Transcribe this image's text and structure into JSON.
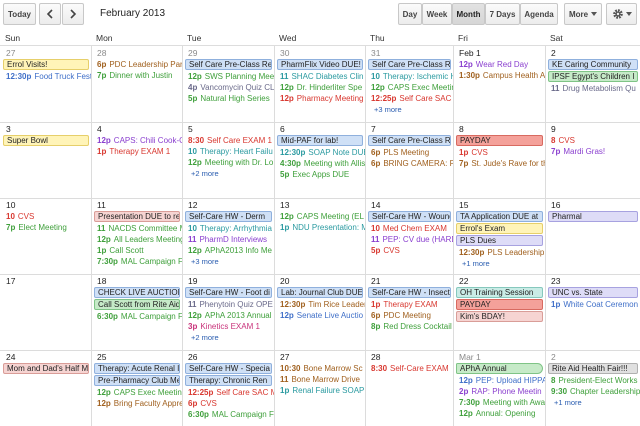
{
  "toolbar": {
    "today_label": "Today",
    "prev_icon": "chevron-left-icon",
    "next_icon": "chevron-right-icon",
    "date_range": "February 2013",
    "views": [
      "Day",
      "Week",
      "Month",
      "7 Days",
      "Agenda"
    ],
    "active_view": "Month",
    "more_label": "More",
    "settings_icon": "gear-icon"
  },
  "colors": {
    "blue": "#3f6fc8",
    "green": "#3e9f3a",
    "purple": "#8a3fcf",
    "brown": "#a0601e",
    "red": "#d8372f",
    "teal": "#2a9aa0",
    "olive": "#6a7a1a",
    "pink": "#c8327a",
    "slate": "#6a6a8a",
    "chip_yellow": "#fff4b8",
    "chip_yellow_border": "#e6cf6a",
    "chip_blue": "#cfe0f6",
    "chip_blue_border": "#8fb0dd",
    "chip_red": "#f4a19a",
    "chip_red_border": "#d86a60",
    "chip_rose": "#f6d4d2",
    "chip_rose_border": "#d99d98",
    "chip_green": "#c6eac8",
    "chip_green_border": "#7fc486",
    "chip_gray": "#e0e0e0",
    "chip_gray_border": "#b0b0b0",
    "chip_lavender": "#dedcf7",
    "chip_lavender_border": "#a7a2e0",
    "chip_teal": "#c9ece6",
    "chip_teal_border": "#86c8bd",
    "today_bg": "#fffbd9"
  },
  "days_of_week": [
    "Sun",
    "Mon",
    "Tue",
    "Wed",
    "Thu",
    "Fri",
    "Sat"
  ],
  "weeks": [
    [
      {
        "day": "27",
        "other": true,
        "items": [
          {
            "kind": "chip",
            "text": "Errol Visits!",
            "style": "yellow"
          },
          {
            "kind": "ev",
            "time": "12:30p",
            "text": "Food Truck Fest",
            "color": "blue"
          }
        ]
      },
      {
        "day": "28",
        "other": true,
        "items": [
          {
            "kind": "ev",
            "time": "6p",
            "text": "PDC Leadership Par",
            "color": "brown"
          },
          {
            "kind": "ev",
            "time": "7p",
            "text": "Dinner with Justin",
            "color": "green"
          }
        ]
      },
      {
        "day": "29",
        "other": true,
        "items": [
          {
            "kind": "chip",
            "text": "Self Care Pre-Class Re",
            "style": "blue"
          },
          {
            "kind": "ev",
            "time": "12p",
            "text": "SWS Planning Mee",
            "color": "green"
          },
          {
            "kind": "ev",
            "time": "4p",
            "text": "Vancomycin Quiz CL",
            "color": "slate"
          },
          {
            "kind": "ev",
            "time": "5p",
            "text": "Natural High Series",
            "color": "green"
          }
        ]
      },
      {
        "day": "30",
        "other": true,
        "items": [
          {
            "kind": "chip",
            "text": "PharmFlix Video DUE!",
            "style": "blue"
          },
          {
            "kind": "ev",
            "time": "11",
            "text": "SHAC Diabetes Clin",
            "color": "teal"
          },
          {
            "kind": "ev",
            "time": "12p",
            "text": "Dr. Hinderliter Spe",
            "color": "green"
          },
          {
            "kind": "ev",
            "time": "12p",
            "text": "Pharmacy Meeting",
            "color": "red"
          }
        ]
      },
      {
        "day": "31",
        "other": true,
        "items": [
          {
            "kind": "chip",
            "text": "Self Care Pre-Class Re",
            "style": "blue"
          },
          {
            "kind": "ev",
            "time": "10",
            "text": "Therapy: Ischemic H",
            "color": "teal"
          },
          {
            "kind": "ev",
            "time": "12p",
            "text": "CAPS Exec Meeting",
            "color": "green"
          },
          {
            "kind": "ev",
            "time": "12:25p",
            "text": "Self Care SAC M",
            "color": "red"
          }
        ],
        "more": "+3 more"
      },
      {
        "day": "Feb 1",
        "other": false,
        "items": [
          {
            "kind": "ev",
            "time": "12p",
            "text": "Wear Red Day",
            "color": "purple"
          },
          {
            "kind": "ev",
            "time": "1:30p",
            "text": "Campus Health A",
            "color": "brown"
          }
        ]
      },
      {
        "day": "2",
        "other": false,
        "items": [
          {
            "kind": "chip",
            "text": "KE Caring Community",
            "style": "blue"
          },
          {
            "kind": "chip",
            "text": "IPSF Egypt's Children I",
            "style": "green"
          },
          {
            "kind": "ev",
            "time": "11",
            "text": "Drug Metabolism Qu",
            "color": "slate"
          }
        ]
      }
    ],
    [
      {
        "day": "3",
        "other": false,
        "items": [
          {
            "kind": "chip",
            "text": "Super Bowl",
            "style": "yellow"
          }
        ]
      },
      {
        "day": "4",
        "other": false,
        "items": [
          {
            "kind": "ev",
            "time": "12p",
            "text": "CAPS: Chili Cook-O",
            "color": "purple"
          },
          {
            "kind": "ev",
            "time": "1p",
            "text": "Therapy EXAM 1",
            "color": "red"
          }
        ]
      },
      {
        "day": "5",
        "other": false,
        "items": [
          {
            "kind": "ev",
            "time": "8:30",
            "text": "Self Care EXAM 1",
            "color": "red"
          },
          {
            "kind": "ev",
            "time": "10",
            "text": "Therapy: Heart Failu",
            "color": "teal"
          },
          {
            "kind": "ev",
            "time": "12p",
            "text": "Meeting with Dr. Lo",
            "color": "green"
          }
        ],
        "more": "+2 more"
      },
      {
        "day": "6",
        "other": false,
        "items": [
          {
            "kind": "chip",
            "text": "Mid-PAF for lab!",
            "style": "blue"
          },
          {
            "kind": "ev",
            "time": "12:30p",
            "text": "SOAP Note DUE",
            "color": "teal"
          },
          {
            "kind": "ev",
            "time": "4:30p",
            "text": "Meeting with Allis",
            "color": "green"
          },
          {
            "kind": "ev",
            "time": "5p",
            "text": "Exec Apps DUE",
            "color": "green"
          }
        ]
      },
      {
        "day": "7",
        "other": false,
        "items": [
          {
            "kind": "chip",
            "text": "Self Care Pre-Class Re",
            "style": "blue"
          },
          {
            "kind": "ev",
            "time": "6p",
            "text": "PLS Meeting",
            "color": "brown"
          },
          {
            "kind": "ev",
            "time": "6p",
            "text": "BRING CAMERA: PD",
            "color": "brown"
          }
        ]
      },
      {
        "day": "8",
        "other": false,
        "items": [
          {
            "kind": "chip",
            "text": "PAYDAY",
            "style": "red"
          },
          {
            "kind": "ev",
            "time": "1p",
            "text": "CVS",
            "color": "red"
          },
          {
            "kind": "ev",
            "time": "7p",
            "text": "St. Jude's Rave for th",
            "color": "brown"
          }
        ]
      },
      {
        "day": "9",
        "other": false,
        "items": [
          {
            "kind": "ev",
            "time": "8",
            "text": "CVS",
            "color": "red"
          },
          {
            "kind": "ev",
            "time": "7p",
            "text": "Mardi Gras!",
            "color": "purple"
          }
        ]
      }
    ],
    [
      {
        "day": "10",
        "other": false,
        "items": [
          {
            "kind": "ev",
            "time": "10",
            "text": "CVS",
            "color": "red"
          },
          {
            "kind": "ev",
            "time": "7p",
            "text": "Elect Meeting",
            "color": "green"
          }
        ]
      },
      {
        "day": "11",
        "other": false,
        "items": [
          {
            "kind": "chip",
            "text": "Presentation DUE to re",
            "style": "rose"
          },
          {
            "kind": "ev",
            "time": "11",
            "text": "NACDS Committee M",
            "color": "green"
          },
          {
            "kind": "ev",
            "time": "12p",
            "text": "All Leaders Meeting",
            "color": "green"
          },
          {
            "kind": "ev",
            "time": "1p",
            "text": "Call Scott",
            "color": "green"
          },
          {
            "kind": "ev",
            "time": "7:30p",
            "text": "MAL Campaign F",
            "color": "green"
          }
        ]
      },
      {
        "day": "12",
        "other": false,
        "items": [
          {
            "kind": "chip",
            "text": "Self-Care HW - Derm",
            "style": "blue"
          },
          {
            "kind": "ev",
            "time": "10",
            "text": "Therapy: Arrhythmia",
            "color": "teal"
          },
          {
            "kind": "ev",
            "time": "11",
            "text": "PharmD Interviews",
            "color": "purple"
          },
          {
            "kind": "ev",
            "time": "12p",
            "text": "APhA2013 Info Me",
            "color": "green"
          }
        ],
        "more": "+3 more"
      },
      {
        "day": "13",
        "other": false,
        "items": [
          {
            "kind": "ev",
            "time": "12p",
            "text": "CAPS Meeting (EL",
            "color": "green"
          },
          {
            "kind": "ev",
            "time": "1p",
            "text": "NDU Presentation: M",
            "color": "teal"
          }
        ]
      },
      {
        "day": "14",
        "other": false,
        "items": [
          {
            "kind": "chip",
            "text": "Self-Care HW - Wound",
            "style": "blue"
          },
          {
            "kind": "ev",
            "time": "10",
            "text": "Med Chem EXAM",
            "color": "red"
          },
          {
            "kind": "ev",
            "time": "11",
            "text": "PEP: CV due (HARD",
            "color": "purple"
          },
          {
            "kind": "ev",
            "time": "5p",
            "text": "CVS",
            "color": "red"
          }
        ]
      },
      {
        "day": "15",
        "other": false,
        "items": [
          {
            "kind": "chip",
            "text": "TA Application DUE at",
            "style": "blue"
          },
          {
            "kind": "chip",
            "text": "Errol's Exam",
            "style": "yellow"
          },
          {
            "kind": "chip",
            "text": "PLS Dues",
            "style": "lavender"
          },
          {
            "kind": "ev",
            "time": "12:30p",
            "text": "PLS Leadership Pa",
            "color": "brown"
          }
        ],
        "more": "+1 more"
      },
      {
        "day": "16",
        "other": false,
        "items": [
          {
            "kind": "chip",
            "text": "Pharmal",
            "style": "lavender"
          }
        ]
      }
    ],
    [
      {
        "day": "17",
        "other": false,
        "items": []
      },
      {
        "day": "18",
        "other": false,
        "items": [
          {
            "kind": "chip",
            "text": "CHECK LIVE AUCTION",
            "style": "blue"
          },
          {
            "kind": "chip",
            "text": "Call Scott from Rite Aid",
            "style": "green"
          },
          {
            "kind": "ev",
            "time": "6:30p",
            "text": "MAL Campaign F",
            "color": "green"
          }
        ]
      },
      {
        "day": "19",
        "other": false,
        "items": [
          {
            "kind": "chip",
            "text": "Self-Care HW - Foot di",
            "style": "blue"
          },
          {
            "kind": "ev",
            "time": "11",
            "text": "Phenytoin Quiz OPE",
            "color": "slate"
          },
          {
            "kind": "ev",
            "time": "12p",
            "text": "APhA 2013 Annual",
            "color": "green"
          },
          {
            "kind": "ev",
            "time": "3p",
            "text": "Kinetics EXAM 1",
            "color": "pink"
          }
        ],
        "more": "+2 more"
      },
      {
        "day": "20",
        "other": false,
        "items": [
          {
            "kind": "chip",
            "text": "Lab: Journal Club DUE",
            "style": "blue"
          },
          {
            "kind": "ev",
            "time": "12:30p",
            "text": "Tim Rice Leadersh",
            "color": "brown"
          },
          {
            "kind": "ev",
            "time": "12p",
            "text": "Senate Live Auctio",
            "color": "blue"
          }
        ]
      },
      {
        "day": "21",
        "other": false,
        "items": [
          {
            "kind": "chip",
            "text": "Self-Care HW - Insect I",
            "style": "blue"
          },
          {
            "kind": "ev",
            "time": "1p",
            "text": "Therapy EXAM",
            "color": "red"
          },
          {
            "kind": "ev",
            "time": "6p",
            "text": "PDC Meeting",
            "color": "brown"
          },
          {
            "kind": "ev",
            "time": "8p",
            "text": "Red Dress Cocktail",
            "color": "green"
          }
        ]
      },
      {
        "day": "22",
        "other": false,
        "items": [
          {
            "kind": "chip",
            "text": "OH Training Session",
            "style": "teal"
          },
          {
            "kind": "chip",
            "text": "PAYDAY",
            "style": "red"
          },
          {
            "kind": "chip",
            "text": "Kim's BDAY!",
            "style": "rose"
          }
        ]
      },
      {
        "day": "23",
        "other": false,
        "items": [
          {
            "kind": "chip",
            "text": "UNC vs. State",
            "style": "lavender"
          },
          {
            "kind": "ev",
            "time": "1p",
            "text": "White Coat Ceremon",
            "color": "blue"
          }
        ]
      }
    ],
    [
      {
        "day": "24",
        "other": false,
        "items": [
          {
            "kind": "chip",
            "text": "Mom and Dad's Half M",
            "style": "rose"
          }
        ]
      },
      {
        "day": "25",
        "other": false,
        "items": [
          {
            "kind": "chip",
            "text": "Therapy: Acute Renal I",
            "style": "blue"
          },
          {
            "kind": "chip",
            "text": "Pre-Pharmacy Club Me",
            "style": "blue"
          },
          {
            "kind": "ev",
            "time": "12p",
            "text": "CAPS Exec Meeting",
            "color": "green"
          },
          {
            "kind": "ev",
            "time": "12p",
            "text": "Bring Faculty Appre",
            "color": "brown"
          }
        ]
      },
      {
        "day": "26",
        "other": false,
        "items": [
          {
            "kind": "chip",
            "text": "Self-Care HW - Specia",
            "style": "blue"
          },
          {
            "kind": "chip",
            "text": "Therapy: Chronic Ren",
            "style": "blue"
          },
          {
            "kind": "ev",
            "time": "12:25p",
            "text": "Self Care SAC Me",
            "color": "red"
          },
          {
            "kind": "ev",
            "time": "6p",
            "text": "CVS",
            "color": "red"
          },
          {
            "kind": "ev",
            "time": "6:30p",
            "text": "MAL Campaign F",
            "color": "green"
          }
        ]
      },
      {
        "day": "27",
        "other": false,
        "items": [
          {
            "kind": "ev",
            "time": "10:30",
            "text": "Bone Marrow Sc",
            "color": "brown"
          },
          {
            "kind": "ev",
            "time": "11",
            "text": "Bone Marrow Drive",
            "color": "brown"
          },
          {
            "kind": "ev",
            "time": "1p",
            "text": "Renal Failure SOAP",
            "color": "teal"
          }
        ]
      },
      {
        "day": "28",
        "other": false,
        "items": [
          {
            "kind": "ev",
            "time": "8:30",
            "text": "Self-Care EXAM",
            "color": "red"
          }
        ]
      },
      {
        "day": "Mar 1",
        "other": true,
        "items": [
          {
            "kind": "chip",
            "text": "APhA Annual",
            "style": "green",
            "arrow": true
          },
          {
            "kind": "ev",
            "time": "12p",
            "text": "PEP: Upload HIPPA",
            "color": "blue"
          },
          {
            "kind": "ev",
            "time": "2p",
            "text": "RAP: Phone Meetin",
            "color": "purple"
          },
          {
            "kind": "ev",
            "time": "7:30p",
            "text": "Meeting with Awa",
            "color": "green"
          },
          {
            "kind": "ev",
            "time": "12p",
            "text": "Annual: Opening",
            "color": "green"
          }
        ]
      },
      {
        "day": "2",
        "other": true,
        "items": [
          {
            "kind": "chip",
            "text": "Rite Aid Health Fair!!!",
            "style": "gray"
          },
          {
            "kind": "ev",
            "time": "8",
            "text": "President-Elect Works",
            "color": "green"
          },
          {
            "kind": "ev",
            "time": "9:30",
            "text": "Chapter Leadership",
            "color": "green"
          }
        ],
        "more": "+1 more"
      }
    ]
  ]
}
